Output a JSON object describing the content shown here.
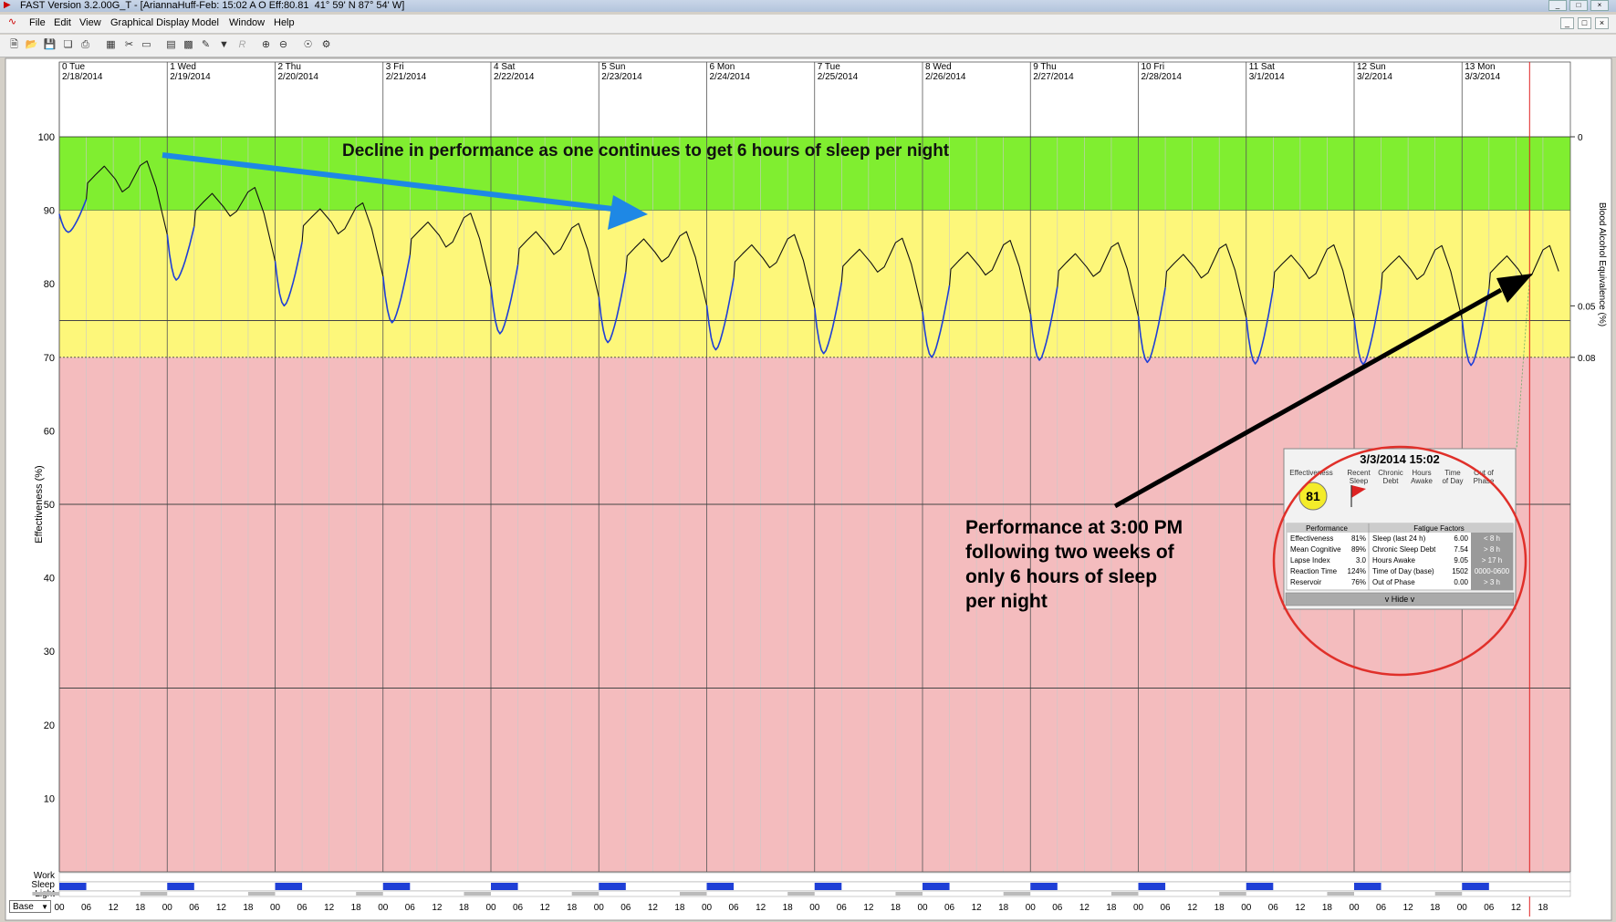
{
  "window": {
    "title": "FAST Version 3.2.00G_T - [AriannaHuff-Feb: 15:02 A O Eff:80.81  41° 59' N 87° 54' W]",
    "controls": [
      "_",
      "□",
      "×"
    ]
  },
  "menu": {
    "items": [
      "File",
      "Edit",
      "View",
      "Graphical Display",
      "Model",
      "Window",
      "Help"
    ]
  },
  "toolbar": {
    "icons": [
      "new-file-icon",
      "open-icon",
      "save-icon",
      "copy-icon",
      "print-icon",
      "grid-icon",
      "cut-icon",
      "comment-icon",
      "table-icon",
      "table2-icon",
      "edit-icon",
      "filter-icon",
      "r-icon",
      "zoom-in-icon",
      "zoom-out-icon",
      "globe-icon",
      "settings-icon"
    ]
  },
  "chart_data": {
    "type": "line",
    "days": [
      {
        "label": "0 Tue",
        "date": "2/18/2014"
      },
      {
        "label": "1 Wed",
        "date": "2/19/2014"
      },
      {
        "label": "2 Thu",
        "date": "2/20/2014"
      },
      {
        "label": "3 Fri",
        "date": "2/21/2014"
      },
      {
        "label": "4 Sat",
        "date": "2/22/2014"
      },
      {
        "label": "5 Sun",
        "date": "2/23/2014"
      },
      {
        "label": "6 Mon",
        "date": "2/24/2014"
      },
      {
        "label": "7 Tue",
        "date": "2/25/2014"
      },
      {
        "label": "8 Wed",
        "date": "2/26/2014"
      },
      {
        "label": "9 Thu",
        "date": "2/27/2014"
      },
      {
        "label": "10 Fri",
        "date": "2/28/2014"
      },
      {
        "label": "11 Sat",
        "date": "3/1/2014"
      },
      {
        "label": "12 Sun",
        "date": "3/2/2014"
      },
      {
        "label": "13 Mon",
        "date": "3/3/2014"
      }
    ],
    "ylabel": "Effectiveness (%)",
    "ylabel_right": "Blood Alcohol Equivalence (%)",
    "ylim": [
      0,
      100
    ],
    "yticks": [
      10,
      20,
      30,
      40,
      50,
      60,
      70,
      80,
      90,
      100
    ],
    "right_ticks": [
      {
        "y": 100,
        "label": "0"
      },
      {
        "y": 77,
        "label": "0.05"
      },
      {
        "y": 70,
        "label": "0.08"
      }
    ],
    "bands": [
      {
        "from": 90,
        "to": 100,
        "color": "#80ee30"
      },
      {
        "from": 70,
        "to": 90,
        "color": "#fdf77a"
      },
      {
        "from": 0,
        "to": 70,
        "color": "#f4bcbe"
      }
    ],
    "reference_lines": [
      75,
      70,
      50,
      25
    ],
    "hour_tick_labels": [
      "00",
      "06",
      "12",
      "18"
    ],
    "x_hours_end": 334,
    "cursor_hour": 327.03,
    "daily": [
      {
        "sleep_min": 87,
        "wake_peak": 96,
        "mid_dip": 92.5,
        "pm_peak": 96.7
      },
      {
        "sleep_min": 80.5,
        "wake_peak": 92.3,
        "mid_dip": 89.2,
        "pm_peak": 93.1
      },
      {
        "sleep_min": 77,
        "wake_peak": 90.2,
        "mid_dip": 86.8,
        "pm_peak": 91
      },
      {
        "sleep_min": 74.7,
        "wake_peak": 88.4,
        "mid_dip": 85,
        "pm_peak": 89.6
      },
      {
        "sleep_min": 73.2,
        "wake_peak": 87.1,
        "mid_dip": 84,
        "pm_peak": 88.2
      },
      {
        "sleep_min": 72,
        "wake_peak": 86.1,
        "mid_dip": 83,
        "pm_peak": 87.1
      },
      {
        "sleep_min": 71,
        "wake_peak": 85.3,
        "mid_dip": 82.2,
        "pm_peak": 86.7
      },
      {
        "sleep_min": 70.5,
        "wake_peak": 84.7,
        "mid_dip": 81.6,
        "pm_peak": 86.2
      },
      {
        "sleep_min": 70,
        "wake_peak": 84.3,
        "mid_dip": 81.2,
        "pm_peak": 85.9
      },
      {
        "sleep_min": 69.6,
        "wake_peak": 84.1,
        "mid_dip": 81,
        "pm_peak": 85.6
      },
      {
        "sleep_min": 69.3,
        "wake_peak": 84,
        "mid_dip": 80.8,
        "pm_peak": 85.4
      },
      {
        "sleep_min": 69.1,
        "wake_peak": 83.9,
        "mid_dip": 80.7,
        "pm_peak": 85.3
      },
      {
        "sleep_min": 69,
        "wake_peak": 83.8,
        "mid_dip": 80.6,
        "pm_peak": 85.2
      },
      {
        "sleep_min": 68.9,
        "wake_peak": 83.8,
        "mid_dip": 80.5,
        "pm_peak": 85.2
      }
    ],
    "sleep_hours": [
      0,
      6
    ],
    "track_labels": [
      "Work",
      "Sleep",
      "Light"
    ],
    "line_color": "#111111",
    "sleep_line_color": "#1f3fd6",
    "cursor_color": "#e02020"
  },
  "annotations": {
    "decline_text": "Decline in performance as one continues to get 6 hours of sleep per night",
    "performance_text": [
      "Performance at 3:00 PM",
      "following two weeks of",
      "only 6 hours of sleep",
      "per night"
    ]
  },
  "popup": {
    "datetime": "3/3/2014 15:02",
    "headers": [
      "Effectiveness",
      "Recent Sleep",
      "Chronic Debt",
      "Hours Awake",
      "Time of Day",
      "Out of Phase"
    ],
    "header_lines": [
      [
        "Effectiveness"
      ],
      [
        "Recent",
        "Sleep"
      ],
      [
        "Chronic",
        "Debt"
      ],
      [
        "Hours",
        "Awake"
      ],
      [
        "Time",
        "of Day"
      ],
      [
        "Out of",
        "Phase"
      ]
    ],
    "effectiveness_badge": "81",
    "performance_title": "Performance",
    "fatigue_title": "Fatigue Factors",
    "performance_rows": [
      {
        "label": "Effectiveness",
        "value": "81%"
      },
      {
        "label": "Mean Cognitive",
        "value": "89%"
      },
      {
        "label": "Lapse Index",
        "value": "3.0"
      },
      {
        "label": "Reaction Time",
        "value": "124%"
      },
      {
        "label": "Reservoir",
        "value": "76%"
      }
    ],
    "fatigue_rows": [
      {
        "label": "Sleep (last 24 h)",
        "value": "6.00",
        "threshold": "< 8 h"
      },
      {
        "label": "Chronic Sleep Debt",
        "value": "7.54",
        "threshold": "> 8 h"
      },
      {
        "label": "Hours Awake",
        "value": "9.05",
        "threshold": "> 17 h"
      },
      {
        "label": "Time of Day (base)",
        "value": "1502",
        "threshold": "0000-0600"
      },
      {
        "label": "Out of Phase",
        "value": "0.00",
        "threshold": "> 3 h"
      }
    ],
    "hide_button": "v Hide v"
  },
  "base_select": {
    "value": "Base"
  }
}
